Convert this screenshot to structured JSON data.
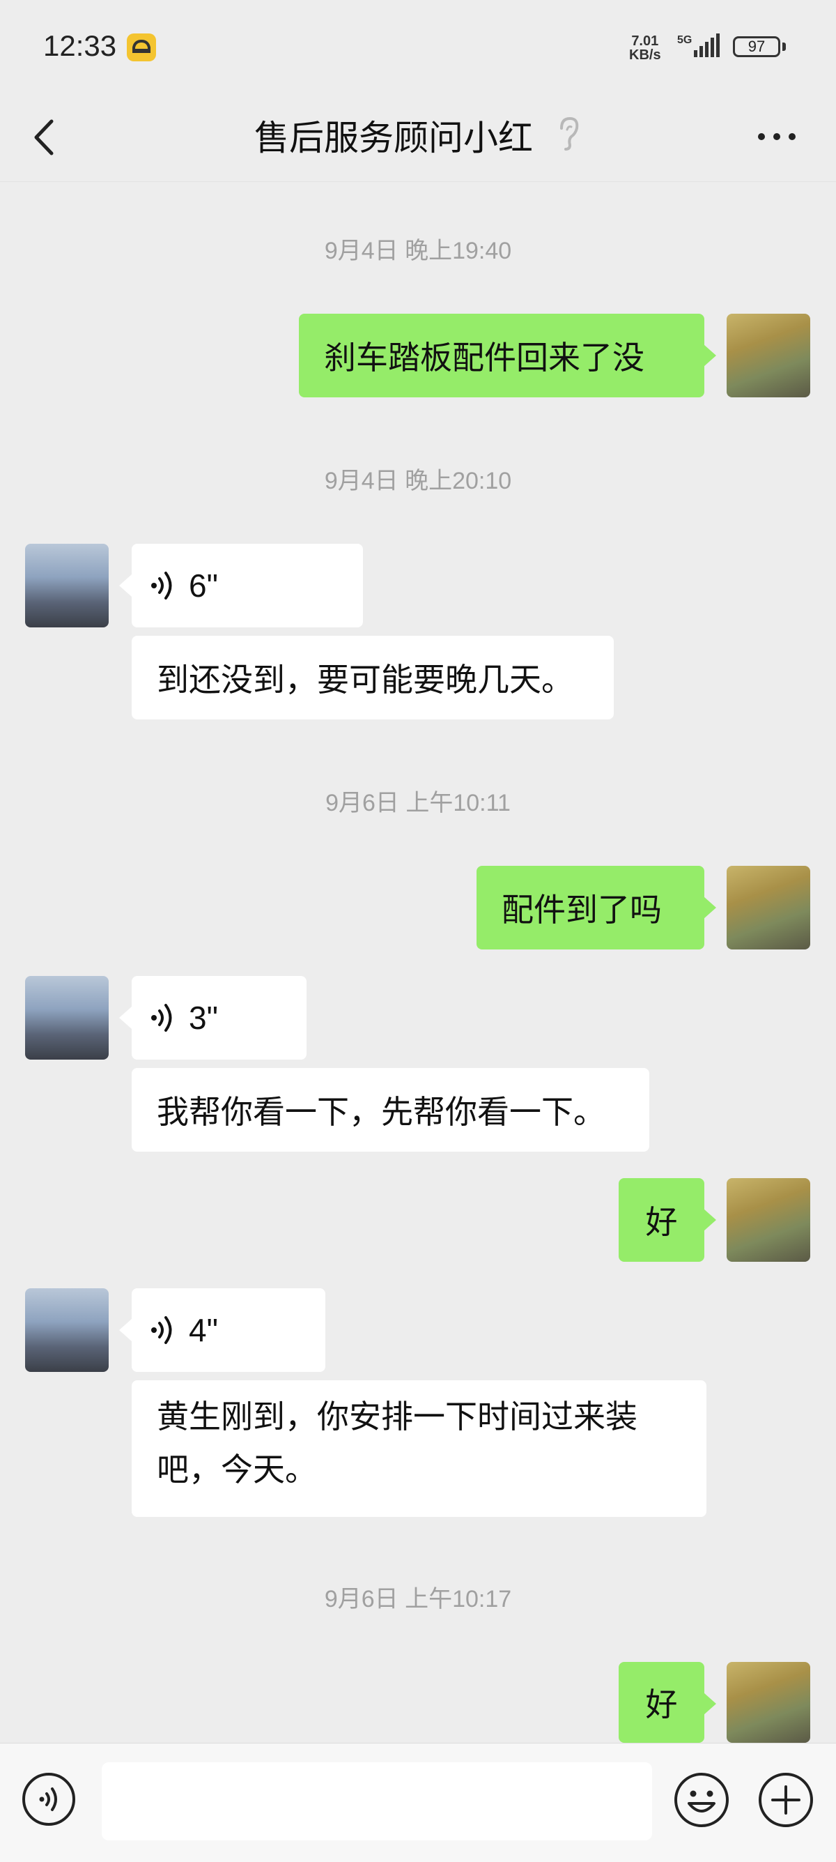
{
  "status_bar": {
    "time": "12:33",
    "net_speed_value": "7.01",
    "net_speed_unit": "KB/s",
    "network": "5G",
    "battery": "97"
  },
  "header": {
    "title": "售后服务顾问小红"
  },
  "messages": [
    {
      "type": "time",
      "text": "9月4日 晚上19:40"
    },
    {
      "type": "text",
      "from": "me",
      "text": "刹车踏板配件回来了没"
    },
    {
      "type": "time",
      "text": "9月4日 晚上20:10"
    },
    {
      "type": "voice",
      "from": "agent",
      "duration": "6\""
    },
    {
      "type": "text",
      "from": "agent",
      "text": "到还没到，要可能要晚几天。"
    },
    {
      "type": "time",
      "text": "9月6日 上午10:11"
    },
    {
      "type": "text",
      "from": "me",
      "text": "配件到了吗"
    },
    {
      "type": "voice",
      "from": "agent",
      "duration": "3\""
    },
    {
      "type": "text",
      "from": "agent",
      "text": "我帮你看一下，先帮你看一下。"
    },
    {
      "type": "text",
      "from": "me",
      "text": "好"
    },
    {
      "type": "voice",
      "from": "agent",
      "duration": "4\""
    },
    {
      "type": "text",
      "from": "agent",
      "text": "黄生刚到，你安排一下时间过来装吧，今天。"
    },
    {
      "type": "time",
      "text": "9月6日 上午10:17"
    },
    {
      "type": "text",
      "from": "me",
      "text": "好"
    }
  ],
  "colors": {
    "outgoing_bubble": "#95ec69",
    "incoming_bubble": "#ffffff",
    "background": "#ededed"
  }
}
